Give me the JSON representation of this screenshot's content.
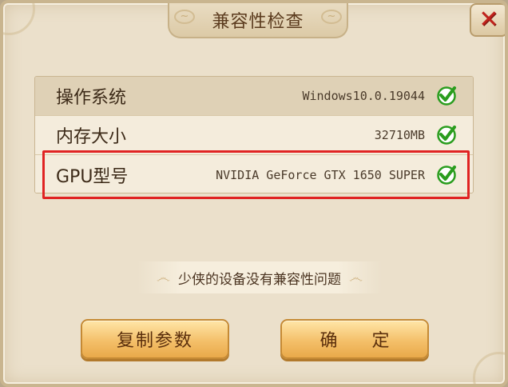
{
  "dialog": {
    "title": "兼容性检查",
    "close_symbol": "✕"
  },
  "rows": [
    {
      "label": "操作系统",
      "value": "Windows10.0.19044",
      "status_icon": "green-check-icon"
    },
    {
      "label": "内存大小",
      "value": "32710MB",
      "status_icon": "green-check-icon"
    },
    {
      "label": "GPU型号",
      "value": "NVIDIA GeForce GTX 1650 SUPER",
      "status_icon": "green-check-icon"
    }
  ],
  "status_message": "少侠的设备没有兼容性问题",
  "buttons": {
    "copy_label": "复制参数",
    "confirm_label": "确 定"
  },
  "colors": {
    "check": "#2a9d1e",
    "highlight_border": "#e02323",
    "close_x": "#c0231c",
    "button_gold": "#f4c06a"
  }
}
